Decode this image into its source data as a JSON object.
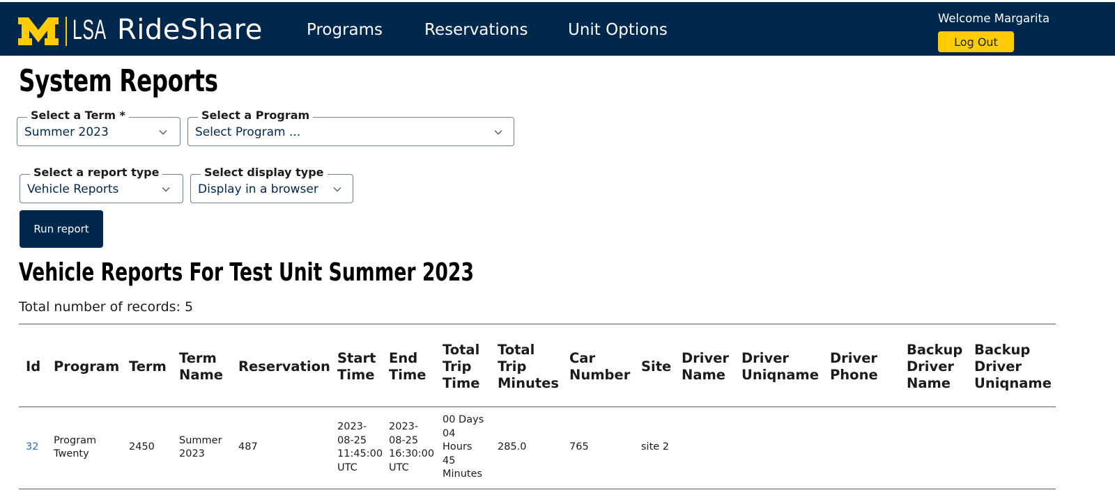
{
  "header": {
    "logo_text": "LSA",
    "brand": "RideShare",
    "nav": [
      "Programs",
      "Reservations",
      "Unit Options"
    ],
    "welcome": "Welcome Margarita",
    "logout_label": "Log Out"
  },
  "page_title": "System Reports",
  "filters": {
    "term": {
      "label": "Select a Term *",
      "value": "Summer 2023"
    },
    "program": {
      "label": "Select a Program",
      "value": "Select Program ..."
    },
    "report_type": {
      "label": "Select a report type",
      "value": "Vehicle Reports"
    },
    "display_type": {
      "label": "Select display type",
      "value": "Display in a browser"
    }
  },
  "run_label": "Run report",
  "report": {
    "title": "Vehicle Reports For Test Unit Summer 2023",
    "count_text": "Total number of records: 5"
  },
  "table": {
    "columns": [
      "Id",
      "Program",
      "Term",
      "Term\nName",
      "Reservation",
      "Start\nTime",
      "End\nTime",
      "Total\nTrip\nTime",
      "Total\nTrip\nMinutes",
      "Car\nNumber",
      "Site",
      "Driver\nName",
      "Driver\nUniqname",
      "Driver\nPhone",
      "Backup\nDriver\nName",
      "Backup\nDriver\nUniqname"
    ],
    "rows": [
      [
        "32",
        "Program\nTwenty",
        "2450",
        "Summer\n2023",
        "487",
        "2023-\n08-25\n11:45:00\nUTC",
        "2023-\n08-25\n16:30:00\nUTC",
        "00 Days\n04\nHours\n45\nMinutes",
        "285.0",
        "765",
        "site 2",
        "",
        "",
        "",
        "",
        ""
      ]
    ]
  },
  "colors": {
    "navy": "#00274c",
    "maize": "#ffcb05",
    "link": "#2f6db3"
  }
}
